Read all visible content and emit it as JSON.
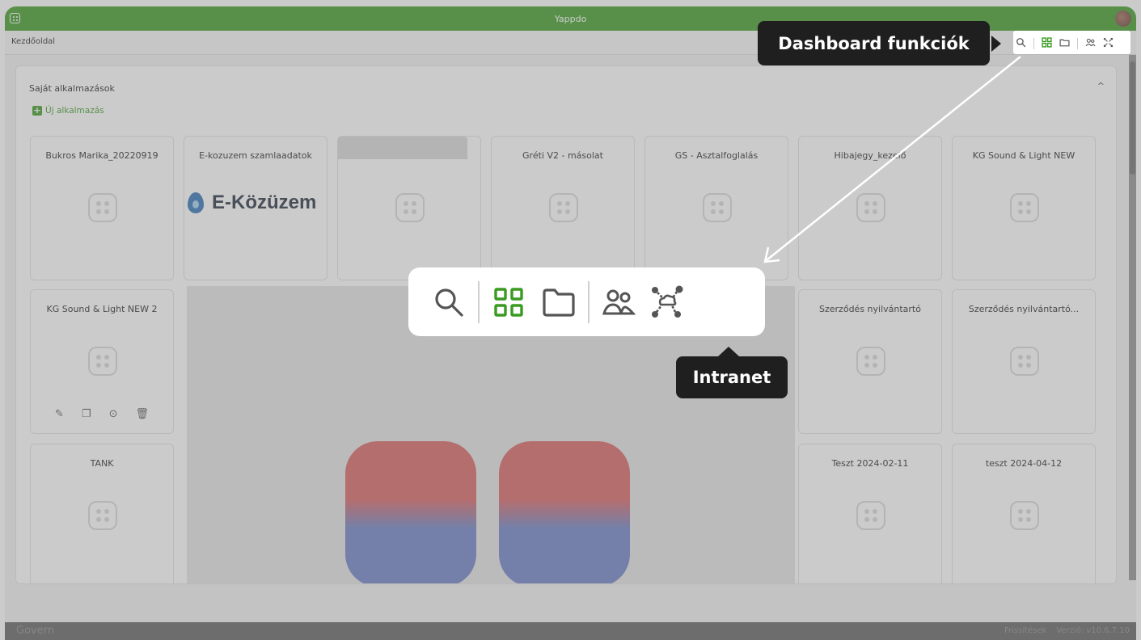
{
  "window": {
    "title": "Yappdo"
  },
  "navbar": {
    "breadcrumb": "Kezdőoldal"
  },
  "panel": {
    "title": "Saját alkalmazások",
    "new_app_label": "Új alkalmazás",
    "collapse_glyph": "^"
  },
  "cards": {
    "c1": "Bukros Marika_20220919",
    "c2": "E-kozuzem szamlaadatok",
    "c3": "Gréti V2 - másolat",
    "c4": "GS - Asztalfoglalás",
    "c5": "Hibajegy_kezelő",
    "c6": "KG Sound & Light NEW",
    "c7": "KG Sound & Light NEW 2",
    "c8": "Szerződés nyilvántartó",
    "c9": "Szerződés nyilvántartó...",
    "c10": "TANK",
    "c11": "Teszt 2024-02-11",
    "c12": "teszt 2024-04-12"
  },
  "logo": {
    "text": "E-Közüzem"
  },
  "callouts": {
    "dashboard": "Dashboard funkciók",
    "intranet": "Intranet"
  },
  "footer": {
    "brand": "Govern",
    "updates": "Frissítések",
    "version": "Verzió: v10.6.7.10"
  },
  "icons": [
    "search-icon",
    "apps-grid-icon",
    "folder-icon",
    "users-icon",
    "intranet-network-icon"
  ],
  "colors": {
    "accent": "#3a9a22",
    "callout_bg": "#1f1f1f"
  }
}
